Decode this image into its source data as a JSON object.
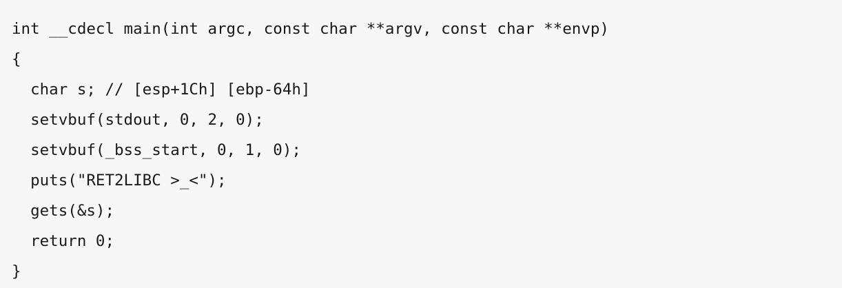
{
  "code": {
    "lines": [
      "int __cdecl main(int argc, const char **argv, const char **envp)",
      "{",
      "  char s; // [esp+1Ch] [ebp-64h]",
      "  setvbuf(stdout, 0, 2, 0);",
      "  setvbuf(_bss_start, 0, 1, 0);",
      "  puts(\"RET2LIBC >_<\");",
      "  gets(&s);",
      "  return 0;",
      "}"
    ]
  }
}
